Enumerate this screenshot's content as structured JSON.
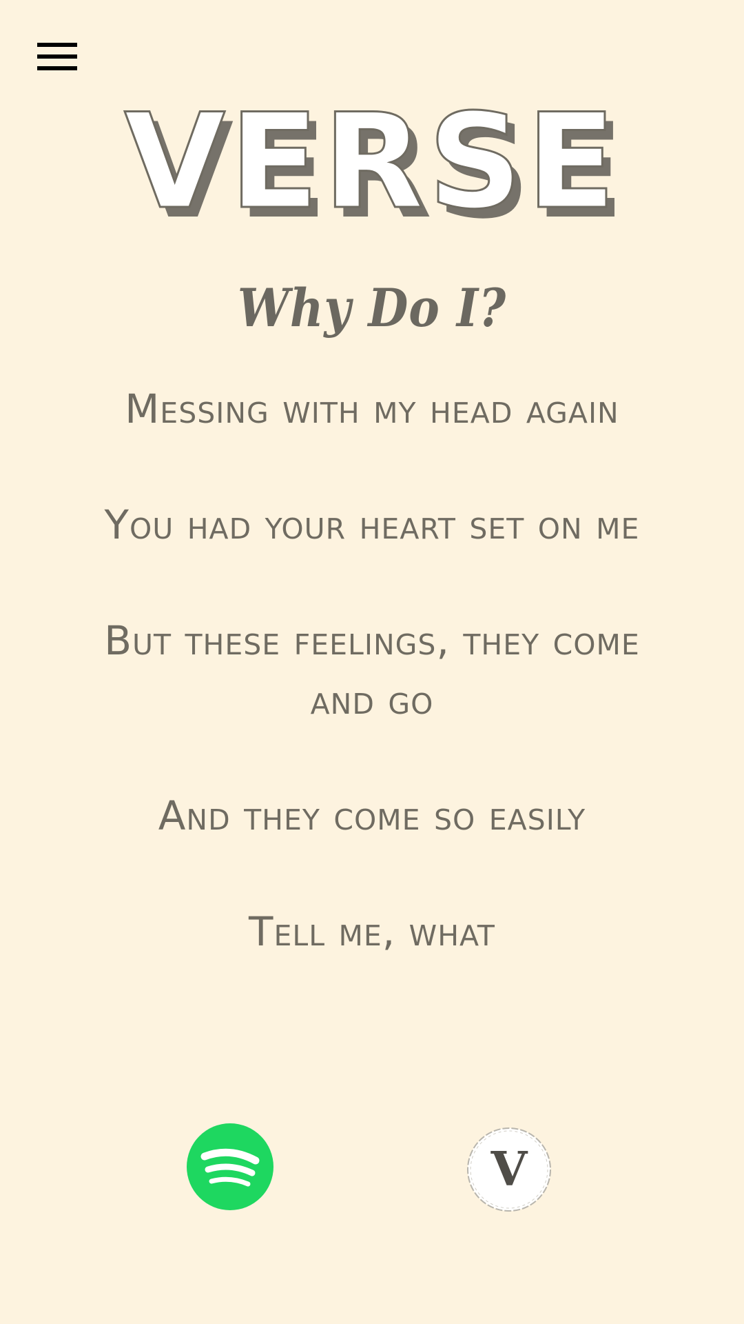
{
  "header": {
    "menu_icon": "hamburger-menu-icon",
    "logo_text": "VERSE"
  },
  "song": {
    "title": "Why Do I?"
  },
  "lyrics": [
    "Messing with my head again",
    "You had your heart set on me",
    "But these feelings, they come and go",
    "And they come so easily",
    "Tell me, what"
  ],
  "footer": {
    "spotify_icon": "spotify-icon",
    "verse_icon": "verse-badge-icon",
    "verse_badge_letter": "V"
  },
  "colors": {
    "background": "#fdf3df",
    "text": "#6f6b61",
    "spotify_green": "#1ed760",
    "logo_shadow": "#76726a"
  }
}
